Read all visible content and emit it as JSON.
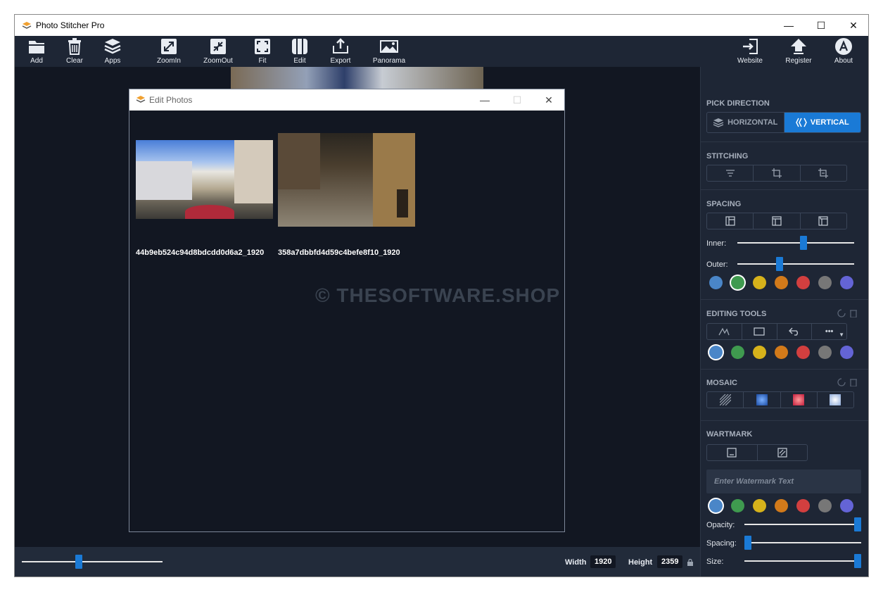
{
  "window": {
    "title": "Photo Stitcher Pro",
    "minimize": "—",
    "maximize": "☐",
    "close": "✕"
  },
  "toolbar": {
    "left": [
      {
        "label": "Add",
        "icon": "folder-icon"
      },
      {
        "label": "Clear",
        "icon": "trash-icon"
      },
      {
        "label": "Apps",
        "icon": "layers-icon"
      },
      {
        "label": "ZoomIn",
        "icon": "zoom-in-icon"
      },
      {
        "label": "ZoomOut",
        "icon": "zoom-out-icon"
      },
      {
        "label": "Fit",
        "icon": "fit-icon"
      },
      {
        "label": "Edit",
        "icon": "edit-columns-icon"
      },
      {
        "label": "Export",
        "icon": "export-icon"
      },
      {
        "label": "Panorama",
        "icon": "panorama-icon"
      }
    ],
    "right": [
      {
        "label": "Website",
        "icon": "website-icon"
      },
      {
        "label": "Register",
        "icon": "register-icon"
      },
      {
        "label": "About",
        "icon": "about-icon"
      }
    ]
  },
  "bottom": {
    "width_label": "Width",
    "width_value": "1920",
    "height_label": "Height",
    "height_value": "2359",
    "zoom_level": 0.4
  },
  "panel": {
    "pick_direction": {
      "title": "PICK DIRECTION",
      "horizontal": "HORIZONTAL",
      "vertical": "VERTICAL",
      "selected": "vertical"
    },
    "stitching": {
      "title": "STITCHING"
    },
    "spacing": {
      "title": "SPACING",
      "inner_label": "Inner:",
      "outer_label": "Outer:",
      "inner_value": 0.57,
      "outer_value": 0.35
    },
    "editing_tools": {
      "title": "EDITING TOOLS",
      "more": "•••"
    },
    "mosaic": {
      "title": "MOSAIC"
    },
    "watermark": {
      "title": "WARTMARK",
      "placeholder": "Enter Watermark Text",
      "opacity_label": "Opacity:",
      "spacing_label": "Spacing:",
      "size_label": "Size:",
      "opacity_value": 1.0,
      "spacing_value": 0.0,
      "size_value": 1.0
    },
    "colors": [
      "#4a86c8",
      "#3f9a4f",
      "#d6b21b",
      "#d27a1a",
      "#d23f3f",
      "#777777",
      "#6464d6"
    ]
  },
  "dialog": {
    "title": "Edit Photos",
    "minimize": "—",
    "maximize": "☐",
    "close": "✕",
    "photos": [
      {
        "filename": "44b9eb524c94d8bdcdd0d6a2_1920"
      },
      {
        "filename": "358a7dbbfd4d59c4befe8f10_1920"
      }
    ]
  },
  "watermark_overlay": "© THESOFTWARE.SHOP"
}
